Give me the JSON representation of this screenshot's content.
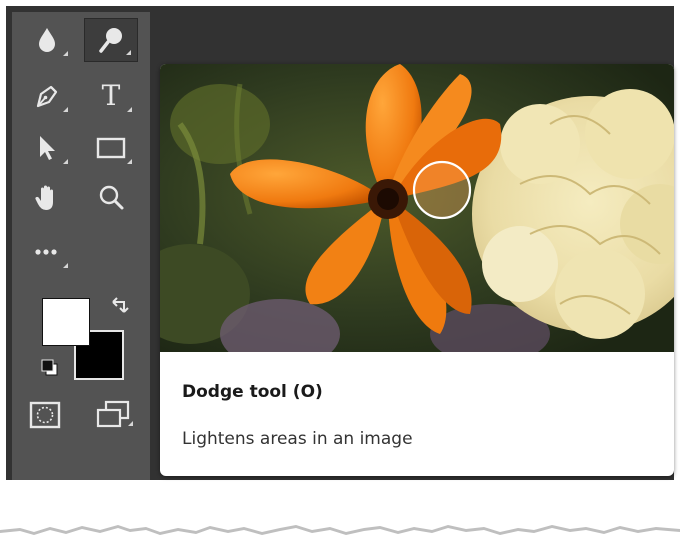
{
  "toolbar": {
    "tools": [
      {
        "name": "blur-tool",
        "icon": "water-drop-icon",
        "selected": false
      },
      {
        "name": "dodge-tool",
        "icon": "dodge-icon",
        "selected": true
      },
      {
        "name": "pen-tool",
        "icon": "pen-icon",
        "selected": false
      },
      {
        "name": "type-tool",
        "icon": "type-icon",
        "label": "T",
        "selected": false
      },
      {
        "name": "path-selection-tool",
        "icon": "arrow-cursor-icon",
        "selected": false
      },
      {
        "name": "rectangle-tool",
        "icon": "rectangle-icon",
        "selected": false
      },
      {
        "name": "hand-tool",
        "icon": "hand-icon",
        "selected": false
      },
      {
        "name": "zoom-tool",
        "icon": "magnifier-icon",
        "selected": false
      },
      {
        "name": "edit-toolbar",
        "icon": "more-icon",
        "selected": false
      }
    ],
    "foreground_color": "#ffffff",
    "background_color": "#000000"
  },
  "tooltip": {
    "title": "Dodge tool (O)",
    "description": "Lightens areas in an image"
  },
  "colors": {
    "app_bg": "#323232",
    "toolbar_bg": "#535353",
    "selected_tool_bg": "#3d3d3d",
    "icon": "#e8e8e8"
  }
}
